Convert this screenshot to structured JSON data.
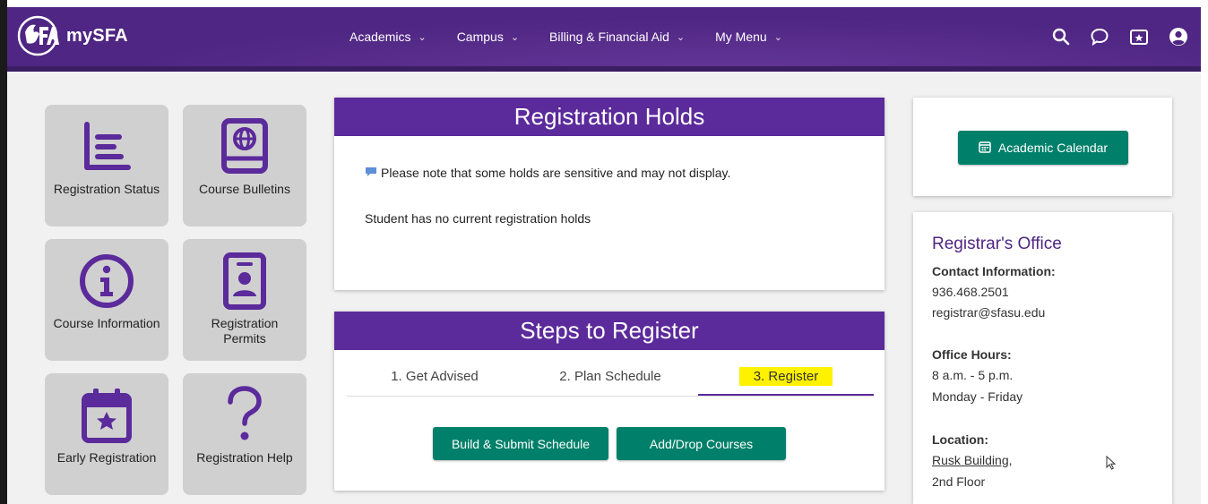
{
  "header": {
    "logo_text": "mySFA",
    "nav": [
      {
        "label": "Academics"
      },
      {
        "label": "Campus"
      },
      {
        "label": "Billing & Financial Aid"
      },
      {
        "label": "My Menu"
      }
    ],
    "icons": [
      "search-icon",
      "chat-icon",
      "favorites-folder-icon",
      "user-account-icon"
    ]
  },
  "tiles": [
    {
      "label": "Registration Status",
      "icon": "list-icon"
    },
    {
      "label": "Course Bulletins",
      "icon": "globe-book-icon"
    },
    {
      "label": "Course Information",
      "icon": "info-icon"
    },
    {
      "label": "Registration Permits",
      "icon": "id-badge-icon"
    },
    {
      "label": "Early Registration",
      "icon": "calendar-star-icon"
    },
    {
      "label": "Registration Help",
      "icon": "question-icon"
    }
  ],
  "holds": {
    "title": "Registration Holds",
    "note": "Please note that some holds are sensitive and may not display.",
    "status": "Student has no current registration holds"
  },
  "steps": {
    "title": "Steps to Register",
    "tabs": [
      {
        "label": "1. Get Advised"
      },
      {
        "label": "2. Plan Schedule"
      },
      {
        "label": "3. Register"
      }
    ],
    "active_tab": "3. Register",
    "buttons": {
      "build": "Build & Submit Schedule",
      "add_drop": "Add/Drop Courses"
    }
  },
  "calendar": {
    "button_label": "Academic Calendar"
  },
  "registrar": {
    "title": "Registrar's Office",
    "contact_heading": "Contact Information:",
    "phone": "936.468.2501",
    "email": "registrar@sfasu.edu",
    "hours_heading": "Office Hours:",
    "hours_time": "8 a.m. - 5 p.m.",
    "hours_days": "Monday - Friday",
    "location_heading": "Location:",
    "location_building": "Rusk Building",
    "location_building_suffix": ",",
    "location_floor": "2nd Floor"
  },
  "colors": {
    "brand_purple": "#4f2683",
    "title_purple": "#5b2a9b",
    "button_green": "#00806a",
    "tile_gray": "#d0d0d0",
    "highlight_yellow": "#fff200"
  }
}
